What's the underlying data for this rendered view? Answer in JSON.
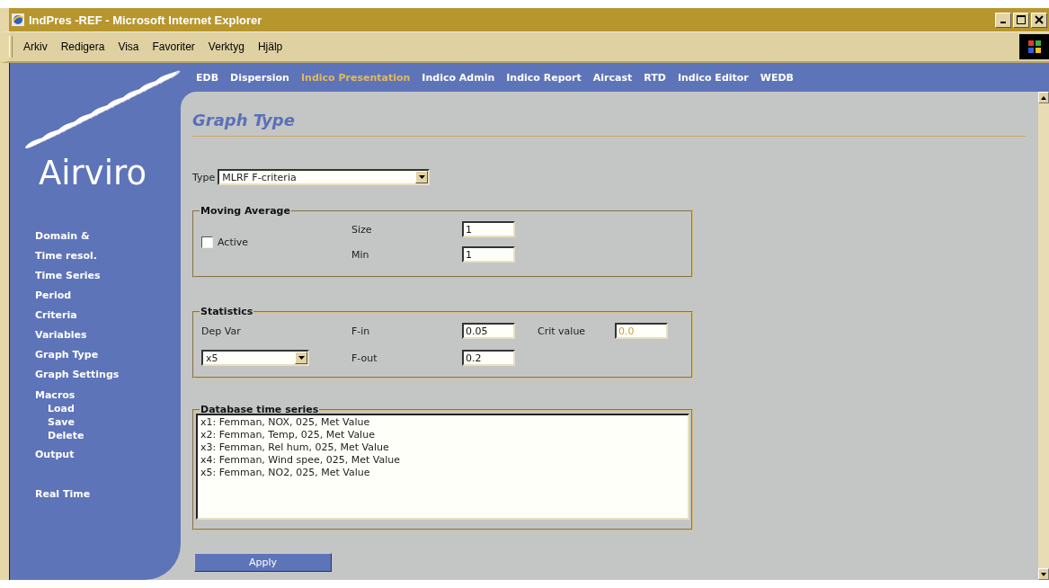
{
  "window": {
    "title": "IndPres -REF - Microsoft Internet Explorer"
  },
  "menu": [
    "Arkiv",
    "Redigera",
    "Visa",
    "Favoriter",
    "Verktyg",
    "Hjälp"
  ],
  "nav": [
    {
      "label": "EDB",
      "selected": false
    },
    {
      "label": "Dispersion",
      "selected": false
    },
    {
      "label": "Indico Presentation",
      "selected": true
    },
    {
      "label": "Indico Admin",
      "selected": false
    },
    {
      "label": "Indico Report",
      "selected": false
    },
    {
      "label": "Aircast",
      "selected": false
    },
    {
      "label": "RTD",
      "selected": false
    },
    {
      "label": "Indico Editor",
      "selected": false
    },
    {
      "label": "WEDB",
      "selected": false
    }
  ],
  "sidebar": {
    "logo": "Airviro",
    "items": [
      {
        "label": "Domain &"
      },
      {
        "label": "Time resol."
      },
      {
        "label": "Time Series"
      },
      {
        "label": "Period"
      },
      {
        "label": "Criteria"
      },
      {
        "label": "Variables"
      },
      {
        "label": "Graph Type"
      },
      {
        "label": "Graph Settings"
      },
      {
        "label": "Macros",
        "children": [
          {
            "label": "Load"
          },
          {
            "label": "Save"
          },
          {
            "label": "Delete"
          }
        ]
      },
      {
        "label": "Output"
      }
    ],
    "footer_items": [
      {
        "label": "Real Time"
      }
    ]
  },
  "page": {
    "heading": "Graph Type",
    "type": {
      "label": "Type",
      "value": "MLRF F-criteria"
    },
    "moving_average": {
      "title": "Moving Average",
      "active": {
        "label": "Active",
        "checked": false
      },
      "size": {
        "label": "Size",
        "value": "1"
      },
      "min": {
        "label": "Min",
        "value": "1"
      }
    },
    "statistics": {
      "title": "Statistics",
      "dep_var": {
        "label": "Dep Var",
        "value": "x5"
      },
      "f_in": {
        "label": "F-in",
        "value": "0.05"
      },
      "f_out": {
        "label": "F-out",
        "value": "0.2"
      },
      "crit_value": {
        "label": "Crit value",
        "value": "0.0",
        "disabled": true
      }
    },
    "database": {
      "title": "Database time series",
      "items": [
        "x1: Femman, NOX, 025, Met Value",
        "x2: Femman, Temp, 025, Met Value",
        "x3: Femman, Rel hum, 025, Met Value",
        "x4: Femman, Wind spee, 025, Met Value",
        "x5: Femman, NO2, 025, Met Value"
      ]
    },
    "apply": "Apply"
  }
}
